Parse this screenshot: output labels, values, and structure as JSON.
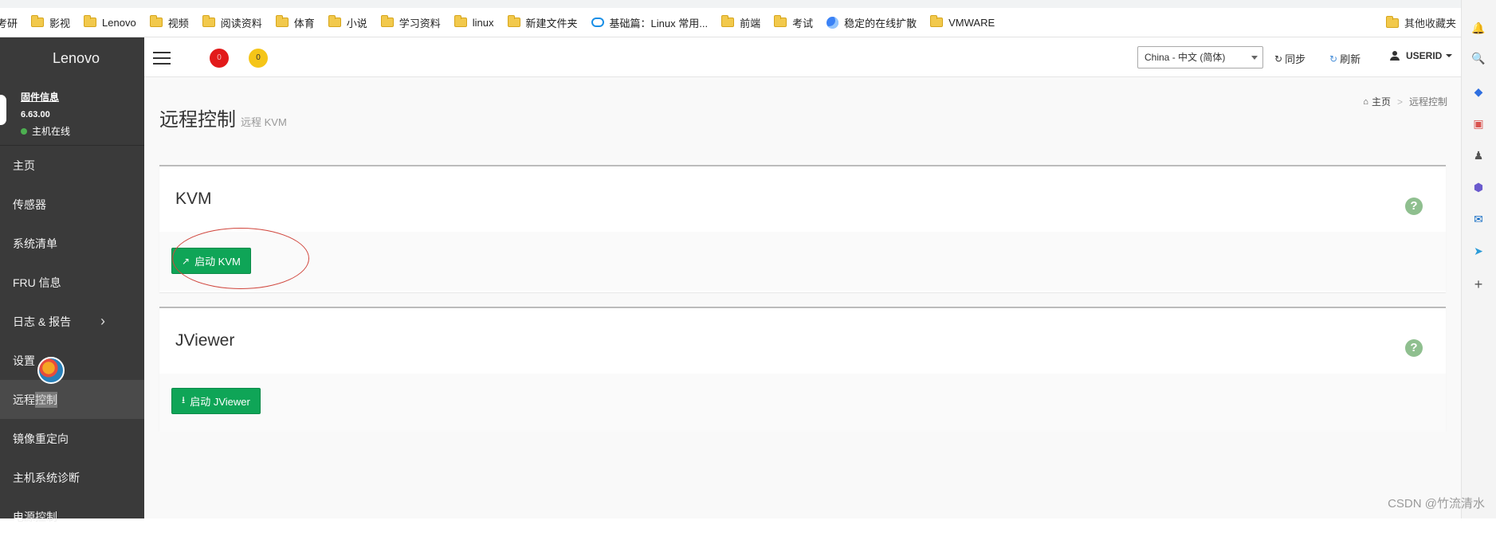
{
  "bookmarks": {
    "items": [
      "考研",
      "影视",
      "Lenovo",
      "视频",
      "阅读资料",
      "体育",
      "小说",
      "学习资料",
      "linux",
      "新建文件夹",
      "基础篇：Linux 常用...",
      "前端",
      "考试",
      "稳定的在线扩散",
      "VMWARE"
    ],
    "other": "其他收藏夹"
  },
  "sidebar": {
    "brand": "Lenovo",
    "fw_title": "固件信息",
    "fw_version": "6.63.00",
    "host_status": "主机在线",
    "items": [
      {
        "label": "主页"
      },
      {
        "label": "传感器"
      },
      {
        "label": "系统清单"
      },
      {
        "label": "FRU 信息"
      },
      {
        "label": "日志 & 报告"
      },
      {
        "label": "设置"
      },
      {
        "label_a": "远程",
        "label_b": "控制"
      },
      {
        "label": "镜像重定向"
      },
      {
        "label": "主机系统诊断"
      },
      {
        "label": "电源控制"
      }
    ]
  },
  "header": {
    "badge_red": "0",
    "badge_yellow": "0",
    "language": "China - 中文 (简体)",
    "sync": "同步",
    "refresh": "刷新",
    "user": "USERID"
  },
  "content": {
    "title": "远程控制",
    "subtitle": "远程 KVM",
    "breadcrumb": {
      "home": "主页",
      "current": "远程控制"
    },
    "kvm": {
      "heading": "KVM",
      "button": "启动 KVM"
    },
    "jviewer": {
      "heading": "JViewer",
      "button": "启动 JViewer"
    }
  },
  "watermark": "CSDN @竹流清水",
  "colors": {
    "sidebar": "#3a3a3a",
    "primary_button": "#0fa557",
    "badge_red": "#e21a1a",
    "badge_yellow": "#f5c518"
  }
}
